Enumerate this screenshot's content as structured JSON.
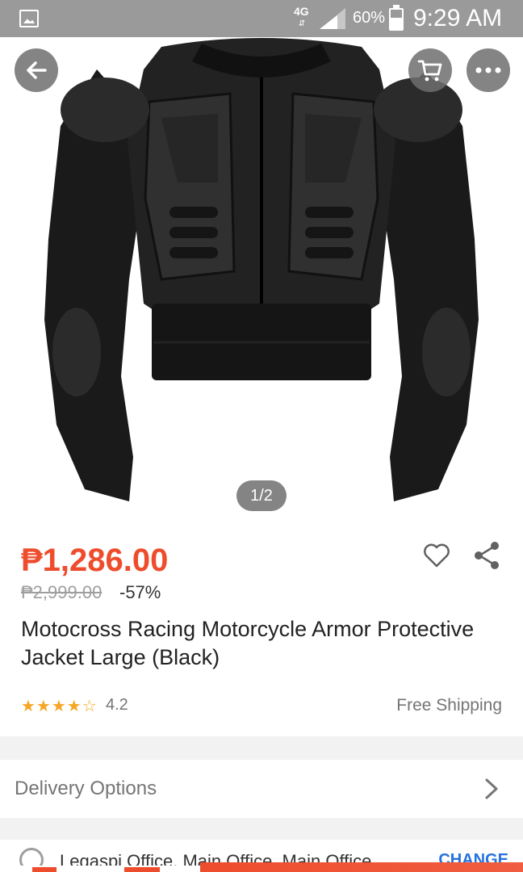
{
  "status_bar": {
    "network": "4G",
    "battery_percent": "60%",
    "time": "9:29 AM"
  },
  "gallery": {
    "counter": "1/2",
    "back_icon": "arrow-left-icon",
    "cart_icon": "cart-icon",
    "more_icon": "more-dots-icon"
  },
  "product": {
    "price": "₱1,286.00",
    "original_price": "₱2,999.00",
    "discount": "-57%",
    "title": "Motocross Racing Motorcycle Armor Protective Jacket Large (Black)",
    "stars": "★★★★☆",
    "rating": "4.2",
    "shipping": "Free Shipping"
  },
  "delivery": {
    "label": "Delivery Options"
  },
  "location_row": {
    "text": "Legaspi Office, Main Office, Main Office",
    "action": "CHANGE"
  },
  "colors": {
    "accent": "#ee4d2d",
    "link": "#2673dd"
  }
}
